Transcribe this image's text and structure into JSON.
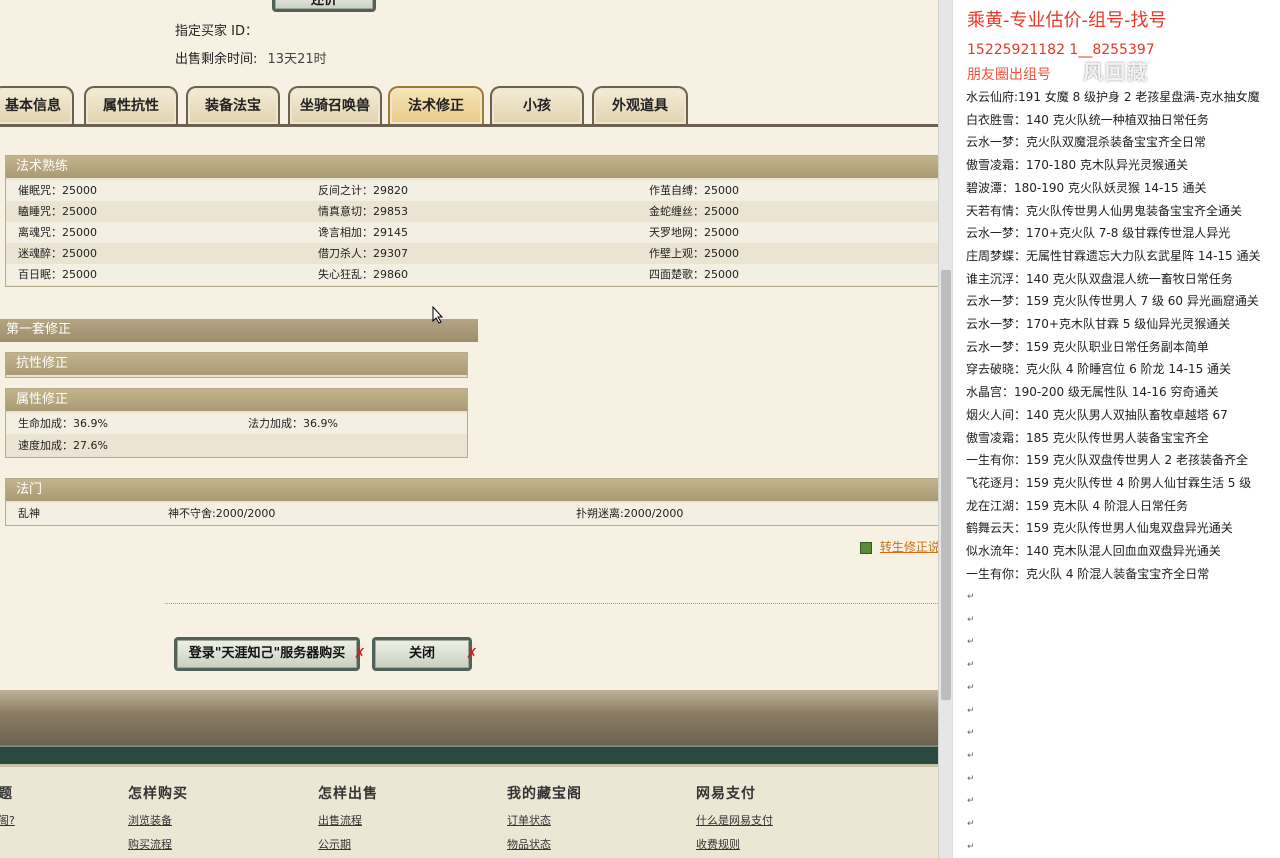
{
  "seller_info": {
    "buyer_id_label": "指定买家 ID：",
    "remaining_label": "出售剩余时间:",
    "remaining_value": "13天21时",
    "top_button": "还价"
  },
  "tabs": [
    {
      "label": "基本信息"
    },
    {
      "label": "属性抗性"
    },
    {
      "label": "装备法宝"
    },
    {
      "label": "坐骑召唤兽"
    },
    {
      "label": "法术修正"
    },
    {
      "label": "小孩"
    },
    {
      "label": "外观道具"
    }
  ],
  "active_tab": "法术修正",
  "spell_mastery": {
    "title": "法术熟练",
    "rows": [
      [
        {
          "name": "催眠咒",
          "value": "25000"
        },
        {
          "name": "反间之计",
          "value": "29820"
        },
        {
          "name": "作茧自缚",
          "value": "25000"
        }
      ],
      [
        {
          "name": "瞌睡咒",
          "value": "25000"
        },
        {
          "name": "情真意切",
          "value": "29853"
        },
        {
          "name": "金蛇缠丝",
          "value": "25000"
        }
      ],
      [
        {
          "name": "离魂咒",
          "value": "25000"
        },
        {
          "name": "谗言相加",
          "value": "29145"
        },
        {
          "name": "天罗地网",
          "value": "25000"
        }
      ],
      [
        {
          "name": "迷魂醉",
          "value": "25000"
        },
        {
          "name": "借刀杀人",
          "value": "29307"
        },
        {
          "name": "作壁上观",
          "value": "25000"
        }
      ],
      [
        {
          "name": "百日眠",
          "value": "25000"
        },
        {
          "name": "失心狂乱",
          "value": "29860"
        },
        {
          "name": "四面楚歌",
          "value": "25000"
        }
      ]
    ]
  },
  "correction": {
    "set_title": "第一套修正",
    "resist_title": "抗性修正",
    "attr_title": "属性修正",
    "hp_bonus": "生命加成：36.9%",
    "mp_bonus": "法力加成：36.9%",
    "speed_bonus": "速度加成：27.6%"
  },
  "school": {
    "title": "法门",
    "items": [
      "乱神",
      "神不守舍:2000/2000",
      "扑朔迷离:2000/2000"
    ]
  },
  "rebirth_link": "转生修正说",
  "buttons": {
    "login_buy": "登录\"天涯知己\"服务器购买",
    "close": "关闭"
  },
  "footer": {
    "columns": [
      {
        "head": "题",
        "links": [
          "阁?"
        ]
      },
      {
        "head": "怎样购买",
        "links": [
          "浏览装备",
          "购买流程"
        ]
      },
      {
        "head": "怎样出售",
        "links": [
          "出售流程",
          "公示期"
        ]
      },
      {
        "head": "我的藏宝阁",
        "links": [
          "订单状态",
          "物品状态"
        ]
      },
      {
        "head": "网易支付",
        "links": [
          "什么是网易支付",
          "收费规则"
        ]
      }
    ]
  },
  "document": {
    "title": "乘黄-专业估价-组号-找号",
    "phone": "15225921182    1__8255397",
    "moments": "朋友圈出组号",
    "watermark": "风回藏",
    "lines": [
      "水云仙府:191 女魔 8 级护身 2 老孩星盘满-克水抽女魔",
      "白衣胜雪：140 克火队统一种植双抽日常任务",
      "云水一梦：克火队双魔混杀装备宝宝齐全日常",
      "傲雪凌霜：170-180 克木队异光灵猴通关",
      "碧波潭：180-190 克火队妖灵猴 14-15 通关",
      "天若有情：克火队传世男人仙男鬼装备宝宝齐全通关",
      "云水一梦：170+克火队 7-8 级甘霖传世混人异光",
      "庄周梦蝶：无属性甘霖遗忘大力队玄武星阵 14-15 通关",
      "谁主沉浮：140 克火队双盘混人统一畜牧日常任务",
      "云水一梦：159 克火队传世男人 7 级 60 异光画窟通关",
      "云水一梦：170+克木队甘霖 5 级仙异光灵猴通关",
      "云水一梦：159 克火队职业日常任务副本简单",
      "穿去破晓：克火队 4 阶睡宫位 6 阶龙 14-15 通关",
      "水晶宫：190-200 级无属性队 14-16 穷奇通关",
      "烟火人间：140 克火队男人双抽队畜牧卓越塔 67",
      "傲雪凌霜：185 克火队传世男人装备宝宝齐全",
      "一生有你：159 克火队双盘传世男人 2 老孩装备齐全",
      "飞花逐月：159 克火队传世 4 阶男人仙甘霖生活 5 级",
      "龙在江湖：159 克木队 4 阶混人日常任务",
      "鹤舞云天：159 克火队传世男人仙鬼双盘异光通关",
      "似水流年：140 克木队混人回血血双盘异光通关",
      "一生有你：克火队 4 阶混人装备宝宝齐全日常"
    ]
  }
}
